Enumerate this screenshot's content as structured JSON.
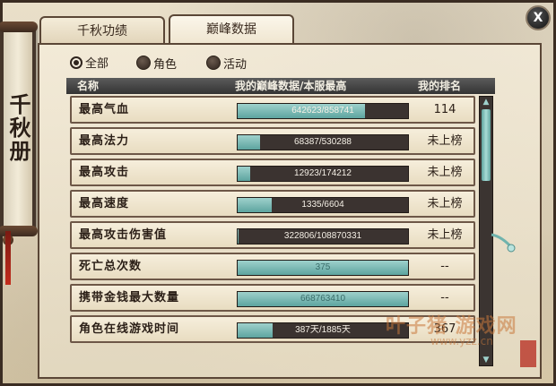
{
  "sidebar": {
    "title": "千秋册"
  },
  "tabs": [
    {
      "label": "千秋功绩",
      "active": false
    },
    {
      "label": "巅峰数据",
      "active": true
    }
  ],
  "close_label": "X",
  "filters": [
    {
      "label": "全部",
      "selected": true
    },
    {
      "label": "角色",
      "selected": false
    },
    {
      "label": "活动",
      "selected": false
    }
  ],
  "table": {
    "headers": {
      "name": "名称",
      "data": "我的巅峰数据/本服最高",
      "rank": "我的排名"
    },
    "rows": [
      {
        "name": "最高气血",
        "value": "642623/858741",
        "progress": 0.748,
        "rank": "114"
      },
      {
        "name": "最高法力",
        "value": "68387/530288",
        "progress": 0.129,
        "rank": "未上榜"
      },
      {
        "name": "最高攻击",
        "value": "12923/174212",
        "progress": 0.074,
        "rank": "未上榜"
      },
      {
        "name": "最高速度",
        "value": "1335/6604",
        "progress": 0.202,
        "rank": "未上榜"
      },
      {
        "name": "最高攻击伤害值",
        "value": "322806/108870331",
        "progress": 0.003,
        "rank": "未上榜"
      },
      {
        "name": "死亡总次数",
        "value": "375",
        "progress": 1.0,
        "rank": "--"
      },
      {
        "name": "携带金钱最大数量",
        "value": "668763410",
        "progress": 1.0,
        "rank": "--"
      },
      {
        "name": "角色在线游戏时间",
        "value": "387天/1885天",
        "progress": 0.205,
        "rank": "367"
      }
    ]
  },
  "watermark": {
    "main": "叶子猪 游戏网",
    "url": "www.yzz.cn"
  },
  "colors": {
    "bar_fill": "#6fb3ad",
    "bar_track": "#3b3330",
    "header_bg": "#454545"
  }
}
